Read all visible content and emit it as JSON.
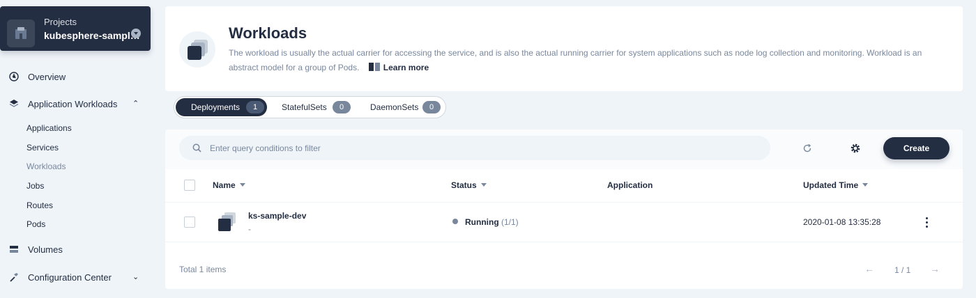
{
  "project": {
    "caption": "Projects",
    "name": "kubesphere-sample..."
  },
  "sidebar": {
    "items": [
      {
        "label": "Overview",
        "icon": "dashboard-icon"
      },
      {
        "label": "Application Workloads",
        "icon": "layers-icon",
        "expanded": true
      },
      {
        "label": "Volumes",
        "icon": "storage-icon"
      },
      {
        "label": "Configuration Center",
        "icon": "hammer-icon",
        "expanded": false
      }
    ],
    "workload_children": [
      "Applications",
      "Services",
      "Workloads",
      "Jobs",
      "Routes",
      "Pods"
    ],
    "active_child": "Workloads"
  },
  "header": {
    "title": "Workloads",
    "description": "The workload is usually the actual carrier for accessing the service, and is also the actual running carrier for system applications such as node log collection and monitoring. Workload is an abstract model for a group of Pods.",
    "learn_more": "Learn more"
  },
  "tabs": [
    {
      "label": "Deployments",
      "count": "1",
      "active": true
    },
    {
      "label": "StatefulSets",
      "count": "0",
      "active": false
    },
    {
      "label": "DaemonSets",
      "count": "0",
      "active": false
    }
  ],
  "toolbar": {
    "search_placeholder": "Enter query conditions to filter",
    "create_label": "Create"
  },
  "table": {
    "columns": [
      "Name",
      "Status",
      "Application",
      "Updated Time"
    ],
    "rows": [
      {
        "name": "ks-sample-dev",
        "description": "-",
        "status": "Running",
        "status_count": "(1/1)",
        "application": "",
        "updated": "2020-01-08 13:35:28"
      }
    ]
  },
  "footer": {
    "total": "Total 1 items",
    "page": "1 / 1"
  },
  "colors": {
    "primary": "#242e42",
    "muted": "#79879c",
    "background": "#eff4f9"
  }
}
